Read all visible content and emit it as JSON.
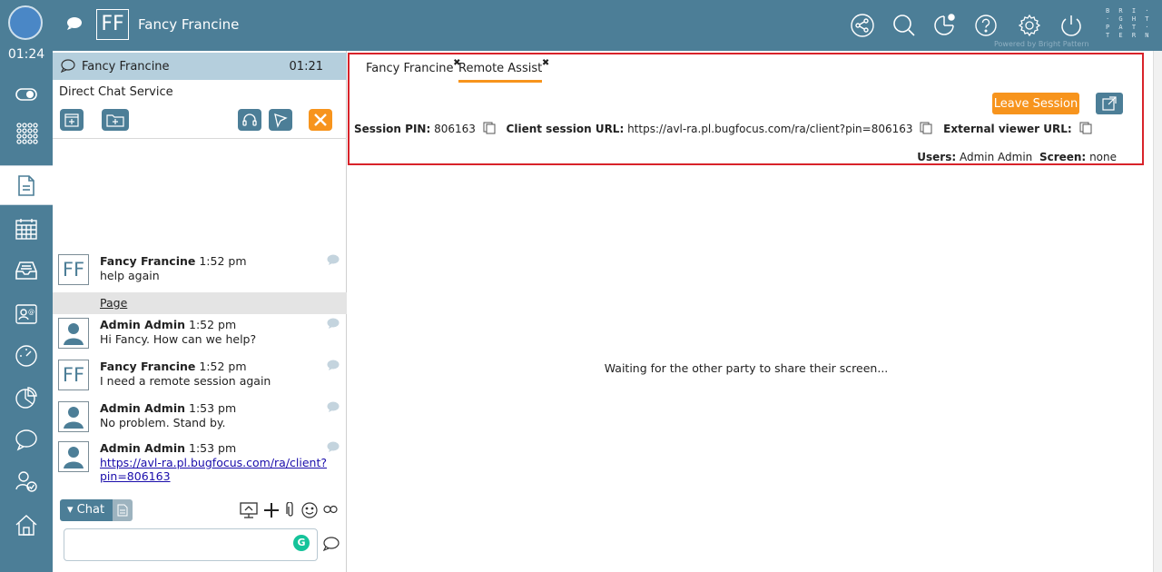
{
  "rail": {
    "clock": "01:24",
    "items": [
      "toggle-icon",
      "apps-grid-icon",
      "documents-icon",
      "calendar-icon",
      "inbox-icon",
      "directory-icon",
      "dashboard-gauge-icon",
      "reports-pie-icon",
      "chat-icon",
      "contact-check-icon",
      "home-icon"
    ],
    "active_item": "documents-icon"
  },
  "topbar": {
    "initials": "FF",
    "contact_name": "Fancy Francine",
    "brand_lines": [
      "B R I ·",
      "· G H T",
      "P A T ·",
      "T E R N"
    ],
    "powered_by": "Powered by Bright Pattern",
    "icons": [
      "share-icon",
      "search-icon",
      "notification-icon",
      "help-icon",
      "settings-icon",
      "power-icon"
    ]
  },
  "chat": {
    "header_name": "Fancy Francine",
    "header_time": "01:21",
    "service": "Direct Chat Service",
    "messages": [
      {
        "initials": "FF",
        "author": "Fancy Francine",
        "time": "1:52 pm",
        "text": "help again"
      },
      {
        "initials": "",
        "author": "Admin Admin",
        "time": "1:52 pm",
        "text": "Hi Fancy. How can we help?"
      },
      {
        "initials": "FF",
        "author": "Fancy Francine",
        "time": "1:52 pm",
        "text": "I need a remote session again"
      },
      {
        "initials": "",
        "author": "Admin Admin",
        "time": "1:53 pm",
        "text": "No problem. Stand by."
      },
      {
        "initials": "",
        "author": "Admin Admin",
        "time": "1:53 pm",
        "link_line1": "https://avl-ra.pl.bugfocus.com/ra/client?",
        "link_line2": "pin=806163"
      }
    ],
    "page_label": "Page",
    "tab_label": "Chat",
    "input_value": ""
  },
  "remote": {
    "tabs": [
      {
        "label": "Fancy Francine",
        "close": "✖"
      },
      {
        "label": "Remote Assist",
        "close": "✖"
      }
    ],
    "active_tab": "Remote Assist",
    "leave_label": "Leave Session",
    "pin_label": "Session PIN:",
    "pin_value": "806163",
    "client_url_label": "Client session URL:",
    "client_url_value": "https://avl-ra.pl.bugfocus.com/ra/client?pin=806163",
    "viewer_label": "External viewer URL:",
    "users_label": "Users:",
    "users_value": "Admin Admin",
    "screen_label": "Screen:",
    "screen_value": "none",
    "waiting_text": "Waiting for the other party to share their screen..."
  },
  "colors": {
    "bar": "#4c7e97",
    "accent": "#f7941d",
    "highlight_box": "#d8232a"
  }
}
